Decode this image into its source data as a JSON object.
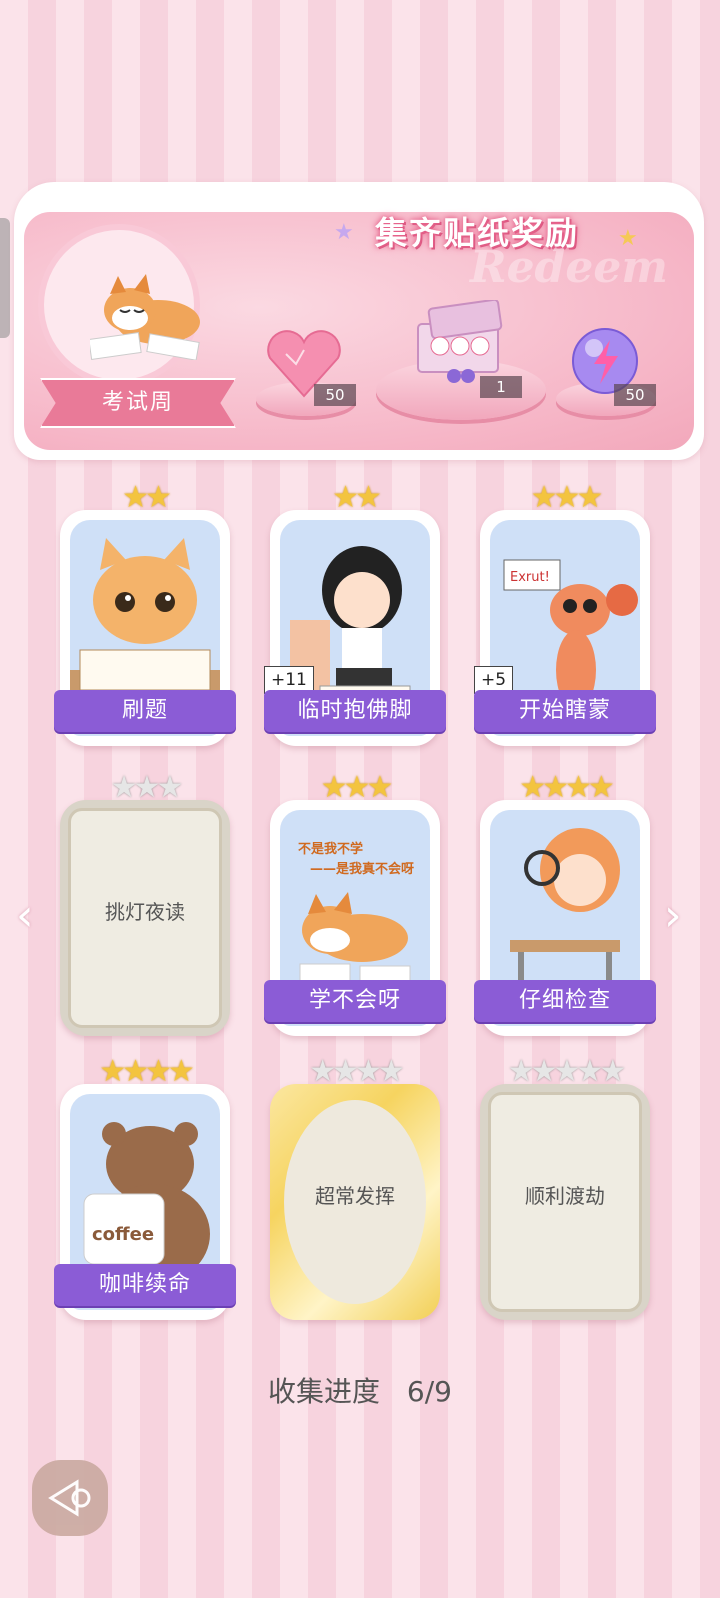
{
  "reward": {
    "title": "集齐贴纸奖励",
    "watermark": "Redeem",
    "theme_label": "考试周",
    "items": [
      {
        "icon": "heart-gem-icon",
        "count": "50"
      },
      {
        "icon": "gift-box-icon",
        "count": "1"
      },
      {
        "icon": "energy-orb-icon",
        "count": "50"
      }
    ]
  },
  "stickers": [
    {
      "name": "刷题",
      "stars": 2,
      "collected": true,
      "bonus": ""
    },
    {
      "name": "临时抱佛脚",
      "stars": 2,
      "collected": true,
      "bonus": "+11"
    },
    {
      "name": "开始瞎蒙",
      "stars": 3,
      "collected": true,
      "bonus": "+5"
    },
    {
      "name": "挑灯夜读",
      "stars": 3,
      "collected": false,
      "bonus": ""
    },
    {
      "name": "学不会呀",
      "stars": 3,
      "collected": true,
      "bonus": ""
    },
    {
      "name": "仔细检查",
      "stars": 4,
      "collected": true,
      "bonus": ""
    },
    {
      "name": "咖啡续命",
      "stars": 4,
      "collected": true,
      "bonus": ""
    },
    {
      "name": "超常发挥",
      "stars": 4,
      "collected": false,
      "bonus": ""
    },
    {
      "name": "顺利渡劫",
      "stars": 5,
      "collected": false,
      "bonus": ""
    }
  ],
  "sticker_art_text": {
    "shrimp_sign": "Exrut!",
    "dog_caption_1": "不是我不学",
    "dog_caption_2": "——是我真不会呀",
    "coffee_cup": "coffee"
  },
  "progress": {
    "label": "收集进度",
    "value": "6/9"
  },
  "colors": {
    "label_bg": "#8b5cd6",
    "star_gold": "#f3c43f",
    "star_grey": "#e6e6e6"
  }
}
